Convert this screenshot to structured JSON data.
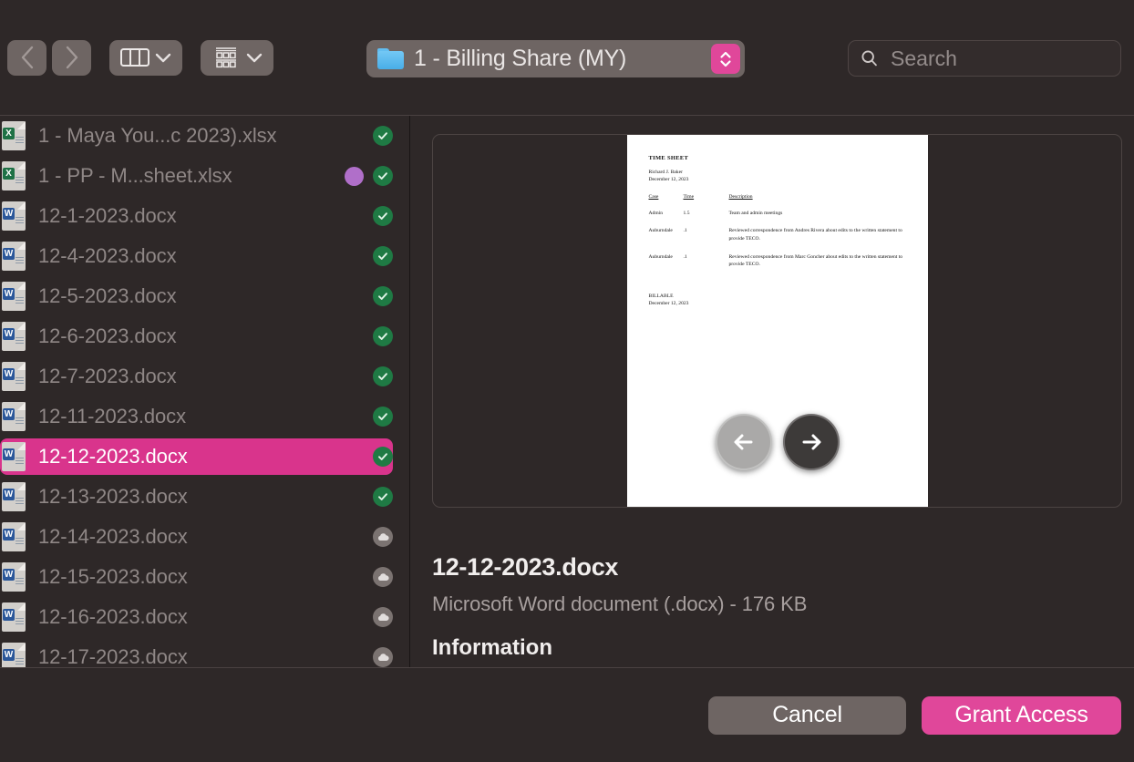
{
  "toolbar": {
    "back_label": "Back",
    "forward_label": "Forward",
    "view_mode_label": "Column view",
    "group_mode_label": "Group items",
    "path": {
      "folder_name": "1 - Billing Share (MY)",
      "icon": "blue-folder-icon",
      "stepper_icon": "up-down-chevron-icon",
      "stepper_color": "#e0479a"
    },
    "search": {
      "placeholder": "Search",
      "value": "",
      "icon": "magnifying-glass-icon"
    }
  },
  "file_list": {
    "items": [
      {
        "name": "1 - Maya You...c 2023).xlsx",
        "kind": "excel",
        "tag": null,
        "badge": "check",
        "selected": false
      },
      {
        "name": "1 - PP - M...sheet.xlsx",
        "kind": "excel",
        "tag": "#b06fc9",
        "badge": "check",
        "selected": false
      },
      {
        "name": "12-1-2023.docx",
        "kind": "word",
        "tag": null,
        "badge": "check",
        "selected": false
      },
      {
        "name": "12-4-2023.docx",
        "kind": "word",
        "tag": null,
        "badge": "check",
        "selected": false
      },
      {
        "name": "12-5-2023.docx",
        "kind": "word",
        "tag": null,
        "badge": "check",
        "selected": false
      },
      {
        "name": "12-6-2023.docx",
        "kind": "word",
        "tag": null,
        "badge": "check",
        "selected": false
      },
      {
        "name": "12-7-2023.docx",
        "kind": "word",
        "tag": null,
        "badge": "check",
        "selected": false
      },
      {
        "name": "12-11-2023.docx",
        "kind": "word",
        "tag": null,
        "badge": "check",
        "selected": false
      },
      {
        "name": "12-12-2023.docx",
        "kind": "word",
        "tag": null,
        "badge": "check",
        "selected": true
      },
      {
        "name": "12-13-2023.docx",
        "kind": "word",
        "tag": null,
        "badge": "check",
        "selected": false
      },
      {
        "name": "12-14-2023.docx",
        "kind": "word",
        "tag": null,
        "badge": "cloud",
        "selected": false
      },
      {
        "name": "12-15-2023.docx",
        "kind": "word",
        "tag": null,
        "badge": "cloud",
        "selected": false
      },
      {
        "name": "12-16-2023.docx",
        "kind": "word",
        "tag": null,
        "badge": "cloud",
        "selected": false
      },
      {
        "name": "12-17-2023.docx",
        "kind": "word",
        "tag": null,
        "badge": "cloud",
        "selected": false
      }
    ],
    "badge_colors": {
      "check": "#1f7a44",
      "cloud": "#7b7371"
    }
  },
  "preview": {
    "prev_label": "Previous page",
    "next_label": "Next page",
    "prev_icon": "arrow-left-icon",
    "next_icon": "arrow-right-icon",
    "document": {
      "title": "TIME SHEET",
      "author": "Richard J. Baker",
      "date": "December 12, 2023",
      "columns": [
        "Case",
        "Time",
        "Description"
      ],
      "rows": [
        {
          "case": "Admin",
          "time": "1.5",
          "description": "Team and admin meetings"
        },
        {
          "case": "Auburndale",
          "time": ".1",
          "description": "Reviewed correspondence from Andres Rivera about edits to the written statement to provide TECO."
        },
        {
          "case": "Auburndale",
          "time": ".1",
          "description": "Reviewed correspondence from Marc Goncher about edits to the written statement to provide TECO."
        }
      ],
      "footer_label": "BILLABLE",
      "footer_date": "December 12, 2023"
    }
  },
  "info": {
    "file_name": "12-12-2023.docx",
    "file_meta": "Microsoft Word document (.docx) - 176 KB",
    "section_title": "Information"
  },
  "footer": {
    "cancel_label": "Cancel",
    "grant_label": "Grant Access",
    "accent_color": "#e0479a"
  }
}
